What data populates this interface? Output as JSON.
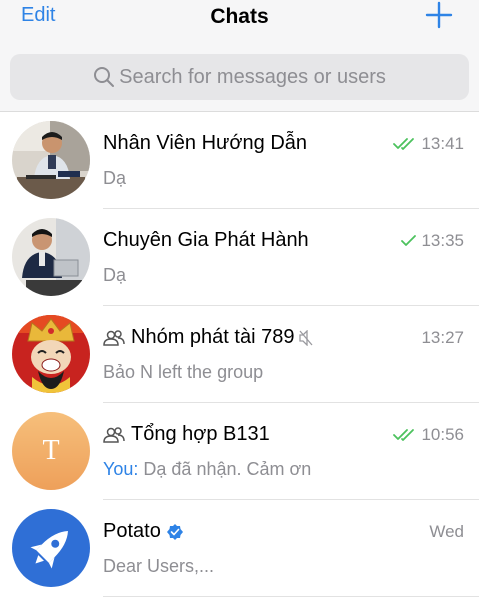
{
  "header": {
    "edit_label": "Edit",
    "title": "Chats"
  },
  "search": {
    "placeholder": "Search for messages or users"
  },
  "colors": {
    "accent": "#2e83e6",
    "read_check": "#4cc25d",
    "meta_gray": "#8e8e93"
  },
  "chats": [
    {
      "name": "Nhân Viên Hướng Dẫn",
      "preview": "Dạ",
      "time": "13:41",
      "status": "read-double-check",
      "avatar": "photo-man-at-desk"
    },
    {
      "name": "Chuyên Gia Phát Hành",
      "preview": "Dạ",
      "time": "13:35",
      "status": "sent-single-check",
      "avatar": "photo-man-with-laptop"
    },
    {
      "name": "Nhóm phát tài 789",
      "preview": "Bảo N left the group",
      "time": "13:27",
      "status": "muted",
      "type": "group",
      "avatar": "god-of-wealth-cartoon"
    },
    {
      "name": "Tổng hợp B131",
      "preview_sender": "You:",
      "preview": "Dạ đã nhận. Cảm ơn",
      "time": "10:56",
      "status": "read-double-check",
      "type": "group",
      "avatar_letter": "T"
    },
    {
      "name": "Potato",
      "preview": "Dear Users,...",
      "time": "Wed",
      "verified": true,
      "avatar": "rocket-logo"
    }
  ]
}
